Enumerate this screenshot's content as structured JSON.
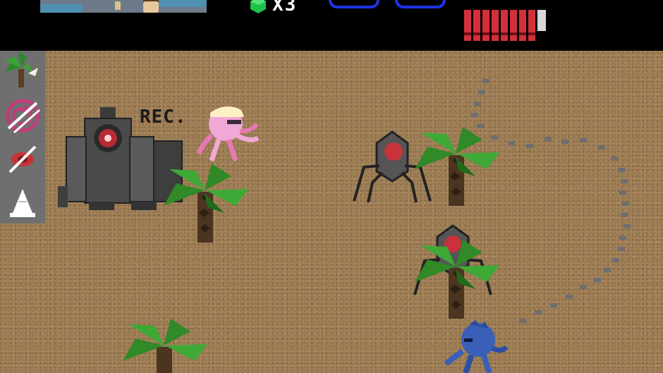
{
  "hud": {
    "minimap_label": "minimap",
    "gem_count": "X3",
    "health_segments_total": 9,
    "health_segments_filled": 8,
    "colors": {
      "health": "#d4303a",
      "item_slot_border": "#1f33e8",
      "gem": "#1ec24a"
    }
  },
  "toolbar": {
    "tools": [
      {
        "icon": "palm-tree-icon"
      },
      {
        "icon": "spiral-icon"
      },
      {
        "icon": "no-camera-icon"
      },
      {
        "icon": "cone-icon"
      }
    ]
  },
  "scene": {
    "rec_label": "REC.",
    "entities": [
      "camera-robot",
      "pink-octopus-player",
      "spider-drone",
      "spider-drone",
      "blue-octopus",
      "palm-tree",
      "palm-tree",
      "palm-tree",
      "palm-tree",
      "footprint-trail"
    ]
  }
}
